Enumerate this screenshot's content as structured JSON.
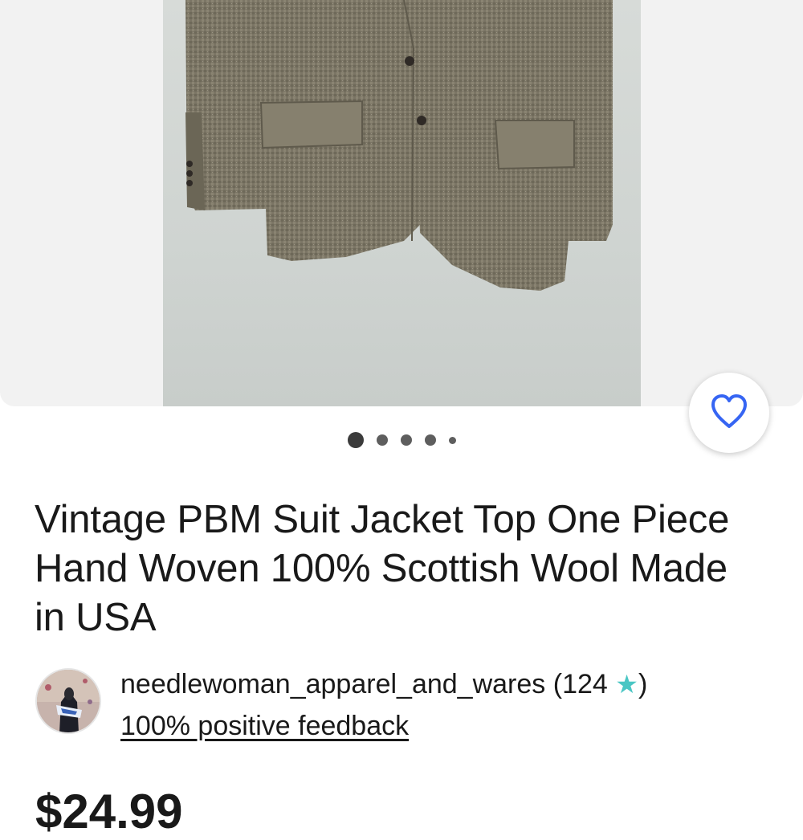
{
  "gallery": {
    "image_alt": "Vintage PBM suit jacket photo",
    "pager": {
      "total": 5,
      "active": 1
    }
  },
  "listing": {
    "title": "Vintage PBM Suit Jacket Top One Piece Hand Woven 100% Scottish Wool Made in USA",
    "price": "$24.99"
  },
  "seller": {
    "name": "needlewoman_apparel_and_wares",
    "rating_count": "124",
    "feedback": "100% positive feedback"
  },
  "icons": {
    "watch": "heart-icon",
    "rating": "star-icon"
  },
  "colors": {
    "heart": "#3665f3",
    "star": "#4ac6c4",
    "text": "#191919"
  }
}
